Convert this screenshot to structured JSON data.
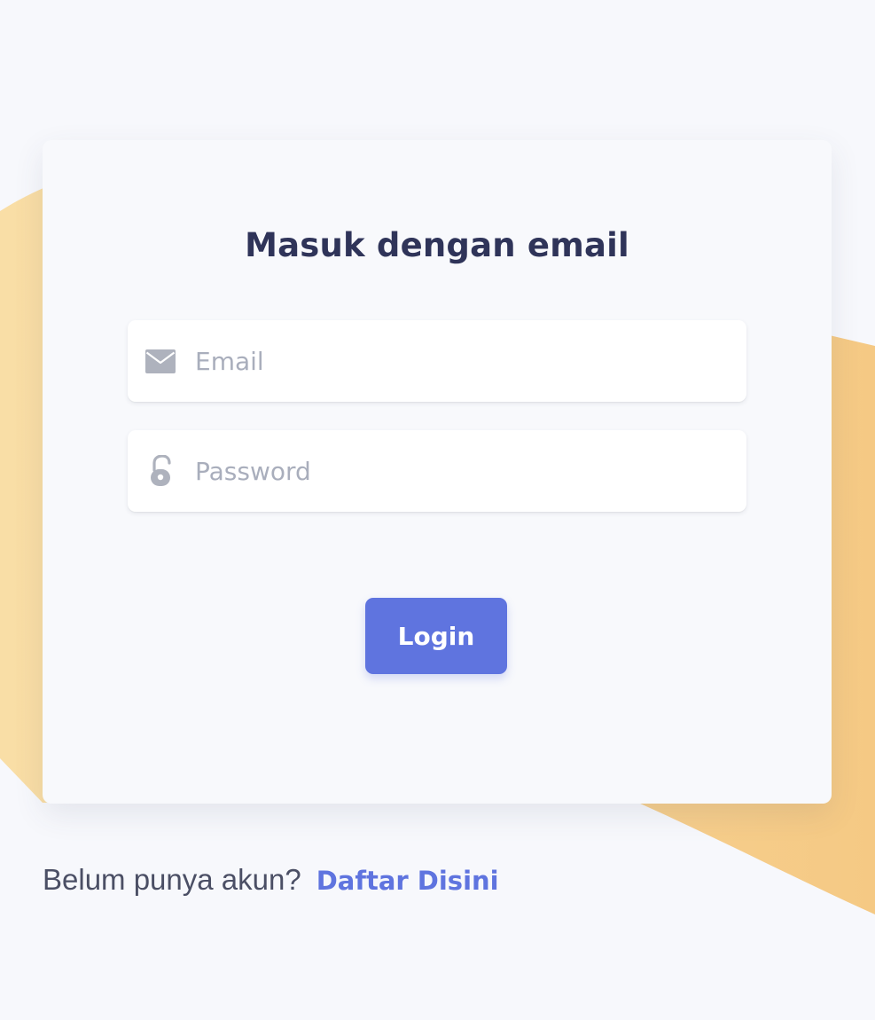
{
  "login": {
    "title": "Masuk dengan email",
    "email": {
      "placeholder": "Email",
      "value": "",
      "icon": "envelope-icon"
    },
    "password": {
      "placeholder": "Password",
      "value": "",
      "icon": "unlocked-padlock-icon"
    },
    "submit_label": "Login"
  },
  "signup": {
    "prompt": "Belum punya akun?",
    "link_label": "Daftar Disini"
  },
  "colors": {
    "page_background": "#f7f8fc",
    "card_background": "#f8f9fc",
    "decorative_shape": "#f8d9a0",
    "title_text": "#2f3459",
    "input_background": "#ffffff",
    "placeholder_text": "#a9aebc",
    "icon": "#aeb2bd",
    "primary_button": "#5f74df",
    "link_text": "#5f74df",
    "body_text": "#4b4f65"
  }
}
